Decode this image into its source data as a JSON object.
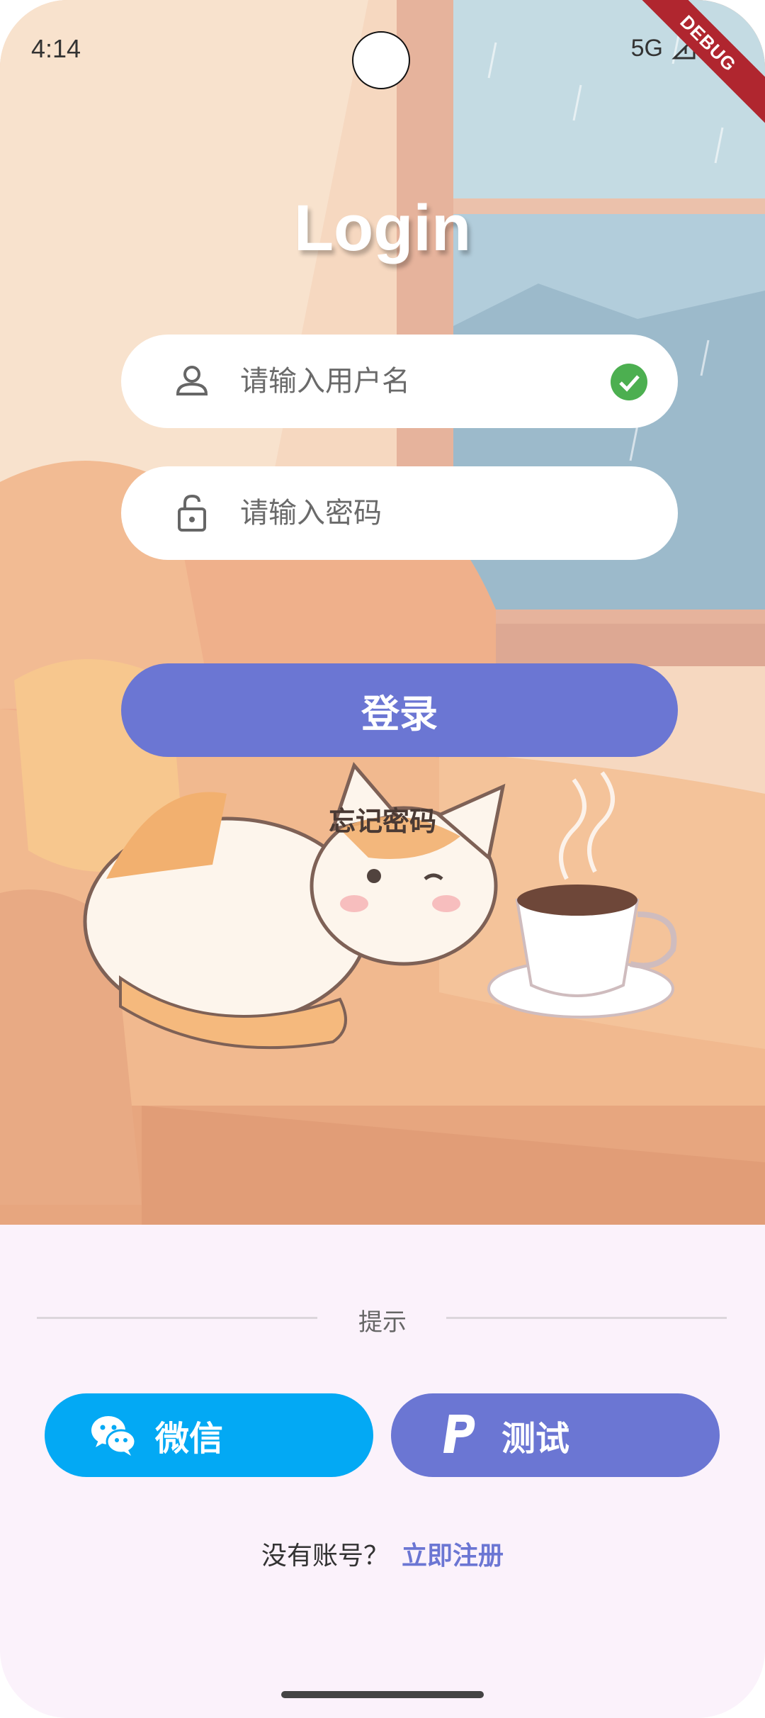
{
  "status": {
    "time": "4:14",
    "network": "5G",
    "debug_label": "DEBUG"
  },
  "title": "Login",
  "username": {
    "placeholder": "请输入用户名",
    "icon": "person-icon",
    "valid_icon": "check-circle-icon"
  },
  "password": {
    "placeholder": "请输入密码",
    "icon": "lock-icon"
  },
  "login_button": "登录",
  "forgot_password": "忘记密码",
  "hint_label": "提示",
  "social": {
    "wechat": {
      "label": "微信",
      "icon": "wechat-icon",
      "color": "#03a9f4"
    },
    "test": {
      "label": "测试",
      "icon": "paypal-icon",
      "color": "#6b76d3"
    }
  },
  "register": {
    "prompt": "没有账号？",
    "link": "立即注册"
  },
  "colors": {
    "accent": "#6b76d3",
    "success": "#4caf50",
    "background": "#fbf2fb"
  }
}
